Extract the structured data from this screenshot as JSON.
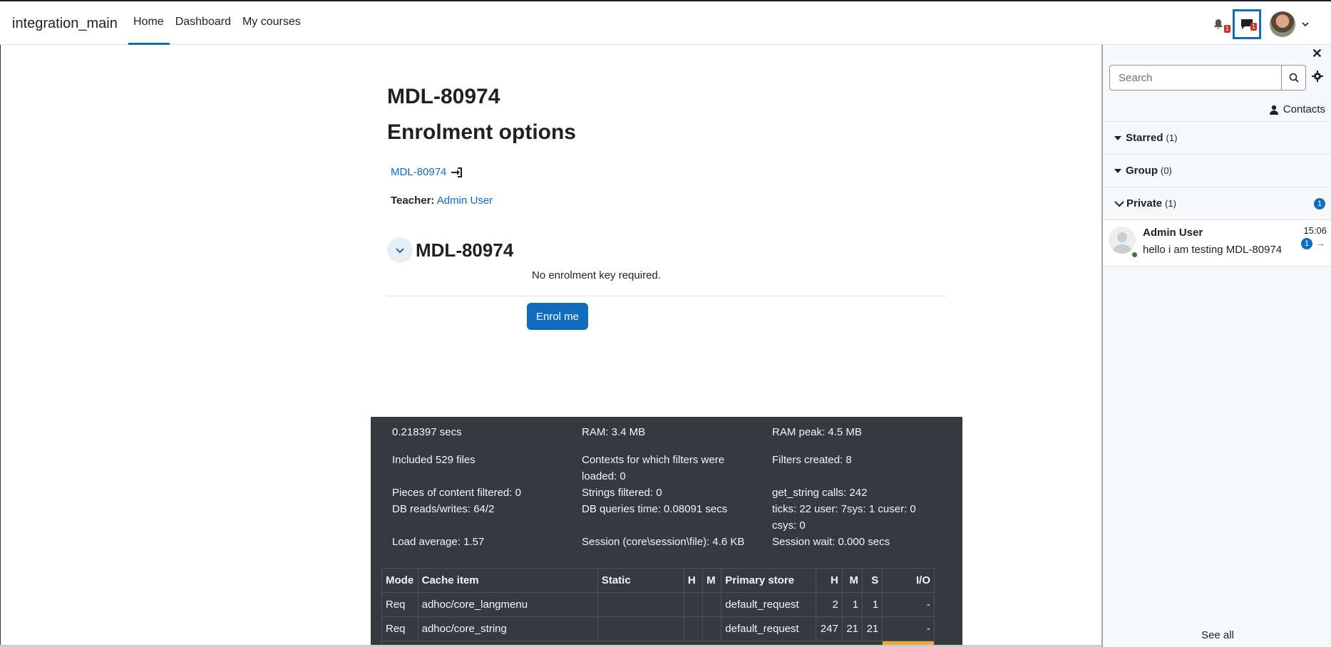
{
  "navbar": {
    "brand": "integration_main",
    "items": [
      {
        "label": "Home",
        "active": true
      },
      {
        "label": "Dashboard"
      },
      {
        "label": "My courses"
      }
    ],
    "notifications_count": "1",
    "messages_count": "1"
  },
  "main": {
    "course_title": "MDL-80974",
    "page_title": "Enrolment options",
    "course_link": "MDL-80974",
    "teacher_label": "Teacher:",
    "teacher_name": "Admin User",
    "section_title": "MDL-80974",
    "no_key_text": "No enrolment key required.",
    "enrol_button": "Enrol me"
  },
  "perf": {
    "rows": [
      [
        "0.218397 secs",
        "RAM: 3.4 MB",
        "RAM peak: 4.5 MB"
      ],
      [
        "Included 529 files",
        "Contexts for which filters were loaded: 0",
        "Filters created: 8"
      ],
      [
        "Pieces of content filtered: 0",
        "Strings filtered: 0",
        "get_string calls: 242"
      ],
      [
        "DB reads/writes: 64/2",
        "DB queries time: 0.08091 secs",
        "ticks: 22 user: 7sys: 1 cuser: 0 csys: 0"
      ],
      [
        "Load average: 1.57",
        "Session (core\\session\\file): 4.6 KB",
        "Session wait: 0.000 secs"
      ]
    ],
    "table": {
      "headers": [
        "Mode",
        "Cache item",
        "Static",
        "H",
        "M",
        "Primary store",
        "H",
        "M",
        "S",
        "I/O"
      ],
      "rows": [
        [
          "Req",
          "adhoc/core_langmenu",
          "",
          "",
          "",
          "default_request",
          "2",
          "1",
          "1",
          "-"
        ],
        [
          "Req",
          "adhoc/core_string",
          "",
          "",
          "",
          "default_request",
          "247",
          "21",
          "21",
          "-"
        ]
      ]
    }
  },
  "drawer": {
    "search_placeholder": "Search",
    "contacts_label": "Contacts",
    "groups": [
      {
        "label": "Starred",
        "count": "(1)"
      },
      {
        "label": "Group",
        "count": "(0)"
      },
      {
        "label": "Private",
        "count": "(1)",
        "unread": "1"
      }
    ],
    "conversation": {
      "name": "Admin User",
      "message": "hello i am testing MDL-80974",
      "time": "15:06",
      "unread": "1"
    },
    "see_all": "See all"
  },
  "colors": {
    "primary": "#0f6cbf",
    "perf_bg": "#343a40",
    "badge_red": "#ca3120",
    "online": "#357a32"
  }
}
